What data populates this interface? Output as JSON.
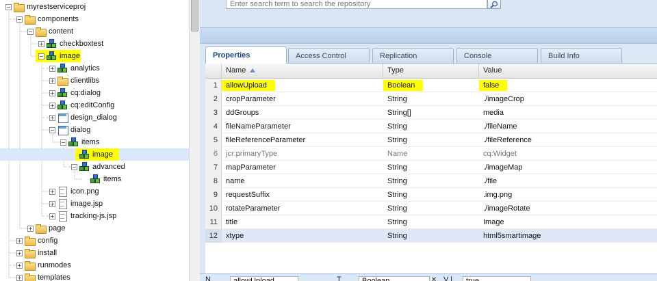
{
  "tree": {
    "nodes": [
      {
        "label": "myrestserviceproj",
        "icon": "folder",
        "expander": "minus",
        "depth": 0,
        "highlight": false,
        "selected": false
      },
      {
        "label": "components",
        "icon": "folder",
        "expander": "minus",
        "depth": 1,
        "highlight": false,
        "selected": false
      },
      {
        "label": "content",
        "icon": "folder",
        "expander": "minus",
        "depth": 2,
        "highlight": false,
        "selected": false
      },
      {
        "label": "checkboxtest",
        "icon": "component",
        "expander": "plus",
        "depth": 3,
        "highlight": false,
        "selected": false
      },
      {
        "label": "image",
        "icon": "component",
        "expander": "minus",
        "depth": 3,
        "highlight": true,
        "selected": false
      },
      {
        "label": "analytics",
        "icon": "component",
        "expander": "plus",
        "depth": 4,
        "highlight": false,
        "selected": false
      },
      {
        "label": "clientlibs",
        "icon": "folder",
        "expander": "plus",
        "depth": 4,
        "highlight": false,
        "selected": false
      },
      {
        "label": "cq:dialog",
        "icon": "component",
        "expander": "plus",
        "depth": 4,
        "highlight": false,
        "selected": false
      },
      {
        "label": "cq:editConfig",
        "icon": "component",
        "expander": "plus",
        "depth": 4,
        "highlight": false,
        "selected": false
      },
      {
        "label": "design_dialog",
        "icon": "dialog",
        "expander": "plus",
        "depth": 4,
        "highlight": false,
        "selected": false
      },
      {
        "label": "dialog",
        "icon": "dialog",
        "expander": "minus",
        "depth": 4,
        "highlight": false,
        "selected": false
      },
      {
        "label": "items",
        "icon": "component",
        "expander": "minus",
        "depth": 5,
        "highlight": false,
        "selected": false
      },
      {
        "label": "image",
        "icon": "component",
        "expander": "none",
        "depth": 6,
        "highlight": true,
        "selected": true
      },
      {
        "label": "advanced",
        "icon": "component",
        "expander": "minus",
        "depth": 6,
        "highlight": false,
        "selected": false
      },
      {
        "label": "items",
        "icon": "component",
        "expander": "none",
        "depth": 7,
        "highlight": false,
        "selected": false
      },
      {
        "label": "icon.png",
        "icon": "file",
        "expander": "plus",
        "depth": 4,
        "highlight": false,
        "selected": false
      },
      {
        "label": "image.jsp",
        "icon": "file",
        "expander": "plus",
        "depth": 4,
        "highlight": false,
        "selected": false
      },
      {
        "label": "tracking-js.jsp",
        "icon": "file",
        "expander": "plus",
        "depth": 4,
        "highlight": false,
        "selected": false
      },
      {
        "label": "page",
        "icon": "folder",
        "expander": "plus",
        "depth": 2,
        "highlight": false,
        "selected": false
      },
      {
        "label": "config",
        "icon": "folder",
        "expander": "plus",
        "depth": 1,
        "highlight": false,
        "selected": false
      },
      {
        "label": "install",
        "icon": "folder",
        "expander": "plus",
        "depth": 1,
        "highlight": false,
        "selected": false
      },
      {
        "label": "runmodes",
        "icon": "folder",
        "expander": "plus",
        "depth": 1,
        "highlight": false,
        "selected": false
      },
      {
        "label": "templates",
        "icon": "folder",
        "expander": "plus",
        "depth": 1,
        "highlight": false,
        "selected": false
      }
    ]
  },
  "search": {
    "placeholder": "Enter search term to search the repository",
    "icon": "search-icon"
  },
  "tabs": [
    {
      "label": "Properties",
      "active": true
    },
    {
      "label": "Access Control",
      "active": false
    },
    {
      "label": "Replication",
      "active": false
    },
    {
      "label": "Console",
      "active": false
    },
    {
      "label": "Build Info",
      "active": false
    }
  ],
  "grid": {
    "headers": {
      "name": "Name",
      "type": "Type",
      "value": "Value"
    },
    "sort_icon": "sort-ascending-icon",
    "rows": [
      {
        "num": "1",
        "name": "allowUpload",
        "type": "Boolean",
        "value": "false",
        "highlight": true,
        "selected": false,
        "dim": false
      },
      {
        "num": "2",
        "name": "cropParameter",
        "type": "String",
        "value": "./imageCrop",
        "highlight": false,
        "selected": false,
        "dim": false
      },
      {
        "num": "3",
        "name": "ddGroups",
        "type": "String[]",
        "value": "media",
        "highlight": false,
        "selected": false,
        "dim": false
      },
      {
        "num": "4",
        "name": "fileNameParameter",
        "type": "String",
        "value": "./fileName",
        "highlight": false,
        "selected": false,
        "dim": false
      },
      {
        "num": "5",
        "name": "fileReferenceParameter",
        "type": "String",
        "value": "./fileReference",
        "highlight": false,
        "selected": false,
        "dim": false
      },
      {
        "num": "6",
        "name": "jcr:primaryType",
        "type": "Name",
        "value": "cq:Widget",
        "highlight": false,
        "selected": false,
        "dim": true
      },
      {
        "num": "7",
        "name": "mapParameter",
        "type": "String",
        "value": "./imageMap",
        "highlight": false,
        "selected": false,
        "dim": false
      },
      {
        "num": "8",
        "name": "name",
        "type": "String",
        "value": "./file",
        "highlight": false,
        "selected": false,
        "dim": false
      },
      {
        "num": "9",
        "name": "requestSuffix",
        "type": "String",
        "value": ".img.png",
        "highlight": false,
        "selected": false,
        "dim": false
      },
      {
        "num": "10",
        "name": "rotateParameter",
        "type": "String",
        "value": "./imageRotate",
        "highlight": false,
        "selected": false,
        "dim": false
      },
      {
        "num": "11",
        "name": "title",
        "type": "String",
        "value": "Image",
        "highlight": false,
        "selected": false,
        "dim": false
      },
      {
        "num": "12",
        "name": "xtype",
        "type": "String",
        "value": "html5smartimage",
        "highlight": false,
        "selected": true,
        "dim": false
      }
    ]
  },
  "editbar": {
    "name_label": "N",
    "name_value": "allowUpload",
    "type_label": "T",
    "type_value": "Boolean",
    "value_label": "V l",
    "value_value": "true"
  }
}
